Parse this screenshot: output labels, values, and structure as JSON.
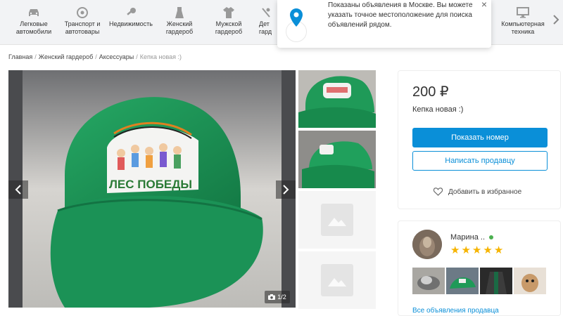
{
  "categories": [
    {
      "label": "Легковые\nавтомобили",
      "icon": "car-icon"
    },
    {
      "label": "Транспорт и\nавтотовары",
      "icon": "wheel-icon"
    },
    {
      "label": "Недвижимость",
      "icon": "key-icon"
    },
    {
      "label": "Женский\nгардероб",
      "icon": "dress-icon"
    },
    {
      "label": "Мужской\nгардероб",
      "icon": "shirt-icon"
    },
    {
      "label": "Дет\nгард",
      "icon": "baby-icon"
    },
    {
      "label": "Компьютерная\nтехника",
      "icon": "monitor-icon"
    }
  ],
  "toast": {
    "message": "Показаны объявления в Москве. Вы можете указать точное местоположение для поиска объявлений рядом.",
    "close": "×"
  },
  "breadcrumbs": {
    "home": "Главная",
    "section": "Женский гардероб",
    "subsection": "Аксессуары",
    "current": "Кепка новая :)",
    "sep": "/"
  },
  "gallery": {
    "counter": "1/2",
    "cap_text": "ЛЕС ПОБЕДЫ",
    "prev": "‹",
    "next": "›"
  },
  "listing": {
    "price": "200 ₽",
    "title": "Кепка новая :)",
    "show_number": "Показать номер",
    "write_seller": "Написать продавцу",
    "favorite": "Добавить в избранное"
  },
  "seller": {
    "name": "Марина ..",
    "rating": 5,
    "all_ads": "Все объявления продавца"
  },
  "colors": {
    "accent": "#0a8fd8",
    "star": "#f6b400",
    "online": "#4cb050",
    "cap_green": "#1f9a58"
  }
}
